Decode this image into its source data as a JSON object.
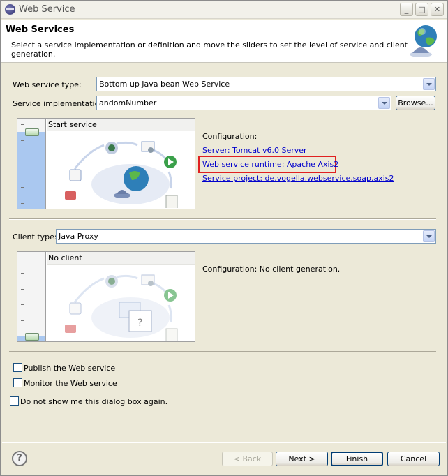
{
  "window": {
    "title": "Web Service",
    "minimize_glyph": "_",
    "maximize_glyph": "□",
    "close_glyph": "✕"
  },
  "header": {
    "title": "Web Services",
    "description": "Select a service implementation or definition and move the sliders to set the level of service and client generation."
  },
  "service": {
    "type_label": "Web service type:",
    "type_value": "Bottom up Java bean Web Service",
    "impl_label": "Service implementation:",
    "impl_value": "andomNumber",
    "browse_label": "Browse...",
    "slider_label": "Start service",
    "slider_level": 0.1,
    "config_label": "Configuration:",
    "server_link": "Server: Tomcat v6.0 Server",
    "runtime_link": "Web service runtime: Apache Axis2",
    "project_link": "Service project: de.vogella.webservice.soap.axis2"
  },
  "client": {
    "type_label": "Client type:",
    "type_value": "Java Proxy",
    "slider_label": "No client",
    "slider_level": 1.0,
    "config_text": "Configuration: No client generation."
  },
  "options": {
    "publish_label": "Publish the Web service",
    "publish_checked": false,
    "monitor_label": "Monitor the Web service",
    "monitor_checked": false,
    "dont_show_label": "Do not show me this dialog box again.",
    "dont_show_checked": false
  },
  "footer": {
    "help_glyph": "?",
    "back_label": "< Back",
    "next_label": "Next >",
    "finish_label": "Finish",
    "cancel_label": "Cancel"
  },
  "colors": {
    "accent": "#003c74",
    "link": "#0000cc",
    "highlight_box": "#e02020",
    "slider_fill": "#aac8f0"
  }
}
